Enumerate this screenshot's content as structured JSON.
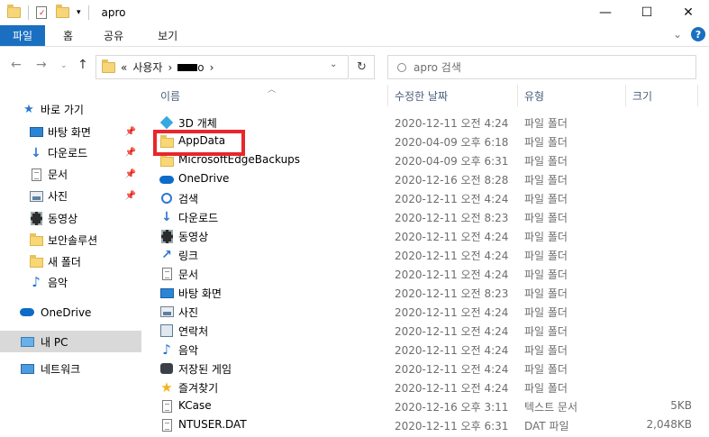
{
  "window": {
    "title": "apro",
    "minimize": "—",
    "maximize": "☐",
    "close": "✕"
  },
  "ribbon": {
    "tabs": [
      "파일",
      "홈",
      "공유",
      "보기"
    ],
    "expand": "⌄",
    "help": "?"
  },
  "address": {
    "prefix": "«",
    "crumb1": "사용자",
    "crumb2_visible": "o",
    "separator": "›",
    "dropdown": "⌄",
    "refresh": "↻"
  },
  "search": {
    "placeholder": "apro 검색"
  },
  "columns": {
    "name": "이름",
    "date": "수정한 날짜",
    "type": "유형",
    "size": "크기"
  },
  "sidebar": {
    "quick_access": "바로 가기",
    "items": [
      {
        "label": "바탕 화면",
        "icon": "desktop-icon",
        "pinned": true
      },
      {
        "label": "다운로드",
        "icon": "download-icon",
        "pinned": true
      },
      {
        "label": "문서",
        "icon": "document-icon",
        "pinned": true
      },
      {
        "label": "사진",
        "icon": "pictures-icon",
        "pinned": true
      },
      {
        "label": "동영상",
        "icon": "video-icon",
        "pinned": false
      },
      {
        "label": "보안솔루션",
        "icon": "folder-icon",
        "pinned": false
      },
      {
        "label": "새 폴더",
        "icon": "folder-icon",
        "pinned": false
      },
      {
        "label": "음악",
        "icon": "music-icon",
        "pinned": false
      }
    ],
    "onedrive": "OneDrive",
    "this_pc": "내 PC",
    "network": "네트워크"
  },
  "files": [
    {
      "name": "3D 개체",
      "date": "2020-12-11 오전 4:24",
      "type": "파일 폴더",
      "size": "",
      "icon": "3d-objects-icon"
    },
    {
      "name": "AppData",
      "date": "2020-04-09 오후 6:18",
      "type": "파일 폴더",
      "size": "",
      "icon": "folder-icon"
    },
    {
      "name": "MicrosoftEdgeBackups",
      "date": "2020-04-09 오후 6:31",
      "type": "파일 폴더",
      "size": "",
      "icon": "folder-icon"
    },
    {
      "name": "OneDrive",
      "date": "2020-12-16 오전 8:28",
      "type": "파일 폴더",
      "size": "",
      "icon": "onedrive-icon"
    },
    {
      "name": "검색",
      "date": "2020-12-11 오전 4:24",
      "type": "파일 폴더",
      "size": "",
      "icon": "search-icon"
    },
    {
      "name": "다운로드",
      "date": "2020-12-11 오전 8:23",
      "type": "파일 폴더",
      "size": "",
      "icon": "download-icon"
    },
    {
      "name": "동영상",
      "date": "2020-12-11 오전 4:24",
      "type": "파일 폴더",
      "size": "",
      "icon": "video-icon"
    },
    {
      "name": "링크",
      "date": "2020-12-11 오전 4:24",
      "type": "파일 폴더",
      "size": "",
      "icon": "link-icon"
    },
    {
      "name": "문서",
      "date": "2020-12-11 오전 4:24",
      "type": "파일 폴더",
      "size": "",
      "icon": "document-icon"
    },
    {
      "name": "바탕 화면",
      "date": "2020-12-11 오전 8:23",
      "type": "파일 폴더",
      "size": "",
      "icon": "desktop-icon"
    },
    {
      "name": "사진",
      "date": "2020-12-11 오전 4:24",
      "type": "파일 폴더",
      "size": "",
      "icon": "pictures-icon"
    },
    {
      "name": "연락처",
      "date": "2020-12-11 오전 4:24",
      "type": "파일 폴더",
      "size": "",
      "icon": "contacts-icon"
    },
    {
      "name": "음악",
      "date": "2020-12-11 오전 4:24",
      "type": "파일 폴더",
      "size": "",
      "icon": "music-icon"
    },
    {
      "name": "저장된 게임",
      "date": "2020-12-11 오전 4:24",
      "type": "파일 폴더",
      "size": "",
      "icon": "saved-games-icon"
    },
    {
      "name": "즐겨찾기",
      "date": "2020-12-11 오전 4:24",
      "type": "파일 폴더",
      "size": "",
      "icon": "favorites-icon"
    },
    {
      "name": "KCase",
      "date": "2020-12-16 오후 3:11",
      "type": "텍스트 문서",
      "size": "5KB",
      "icon": "text-file-icon"
    },
    {
      "name": "NTUSER.DAT",
      "date": "2020-12-11 오후 6:31",
      "type": "DAT 파일",
      "size": "2,048KB",
      "icon": "file-icon"
    }
  ],
  "highlight_color": "#e8262b",
  "accent_color": "#1a6fc0"
}
